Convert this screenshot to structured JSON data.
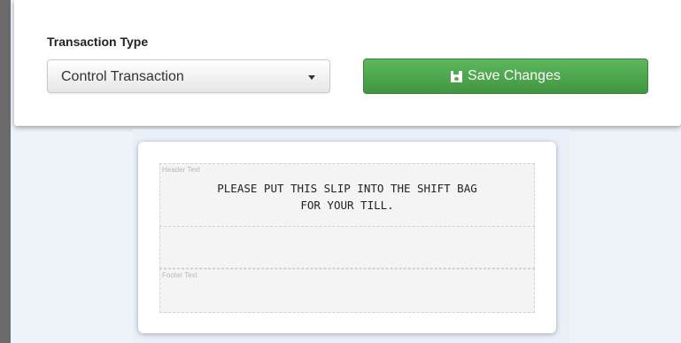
{
  "transaction": {
    "label": "Transaction Type",
    "selected_value": "Control Transaction",
    "save_label": "Save Changes"
  },
  "receipt": {
    "header_label": "Header Text",
    "header_text": "PLEASE PUT THIS SLIP INTO THE SHIFT BAG\nFOR YOUR TILL.",
    "footer_label": "Footer Text"
  },
  "colors": {
    "save_button": "#4cae4c",
    "canvas_background": "#e9f0f8"
  },
  "icons": {
    "save": "floppy-disk-icon",
    "select": "caret-down-icon"
  }
}
